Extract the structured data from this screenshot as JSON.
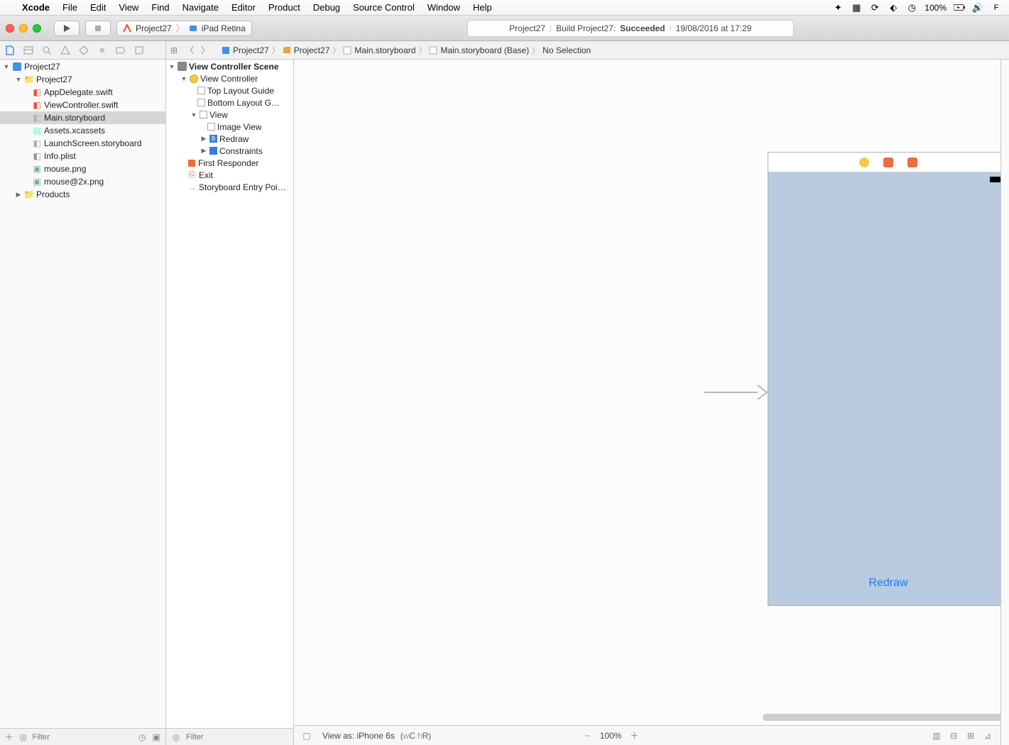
{
  "menubar": {
    "app": "Xcode",
    "items": [
      "File",
      "Edit",
      "View",
      "Find",
      "Navigate",
      "Editor",
      "Product",
      "Debug",
      "Source Control",
      "Window",
      "Help"
    ],
    "battery": "100%"
  },
  "toolbar": {
    "scheme_target": "Project27",
    "scheme_device": "iPad Retina",
    "activity_project": "Project27",
    "activity_prefix": "Build Project27:",
    "activity_status": "Succeeded",
    "activity_time": "19/08/2016 at 17:29"
  },
  "jumpbar": {
    "items": [
      "Project27",
      "Project27",
      "Main.storyboard",
      "Main.storyboard (Base)",
      "No Selection"
    ]
  },
  "navigator": {
    "root": "Project27",
    "group": "Project27",
    "files": [
      "AppDelegate.swift",
      "ViewController.swift",
      "Main.storyboard",
      "Assets.xcassets",
      "LaunchScreen.storyboard",
      "Info.plist",
      "mouse.png",
      "mouse@2x.png"
    ],
    "products": "Products",
    "filter_placeholder": "Filter"
  },
  "outline": {
    "scene": "View Controller Scene",
    "vc": "View Controller",
    "top_guide": "Top Layout Guide",
    "bottom_guide": "Bottom Layout G…",
    "view": "View",
    "imageview": "Image View",
    "redraw": "Redraw",
    "constraints": "Constraints",
    "first_responder": "First Responder",
    "exit": "Exit",
    "entry": "Storyboard Entry Poi…",
    "filter_placeholder": "Filter"
  },
  "canvas": {
    "button_label": "Redraw",
    "viewas_label": "View as: iPhone 6s",
    "viewas_sizeclass_w": "w",
    "viewas_sizeclass_c": "C",
    "viewas_sizeclass_h": "h",
    "viewas_sizeclass_r": "R",
    "zoom": "100%"
  }
}
